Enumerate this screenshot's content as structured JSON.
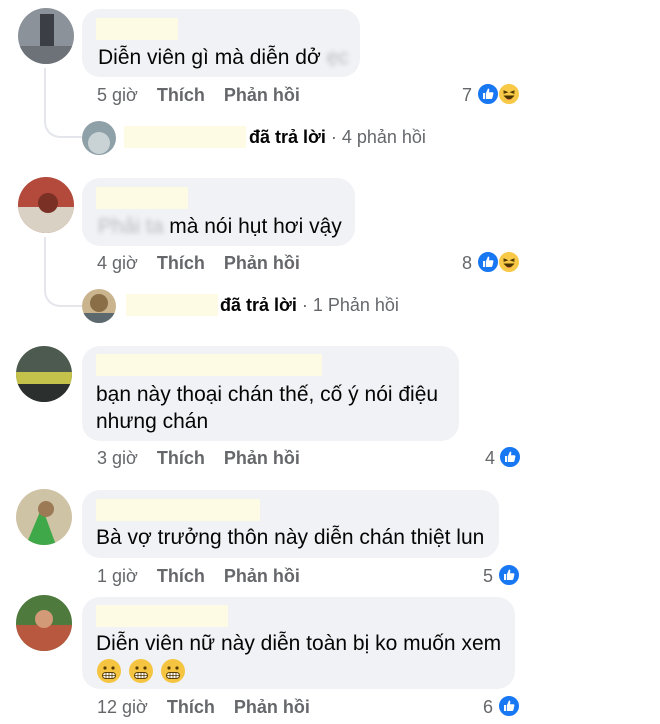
{
  "comments": [
    {
      "text": "Diễn viên gì mà diễn dở",
      "blurred_tail": "ẹc",
      "time": "5 giờ",
      "like": "Thích",
      "reply": "Phản hồi",
      "reaction_count": "7",
      "reactions": [
        "like-icon",
        "haha-icon"
      ],
      "replies": {
        "verb": "đã trả lời",
        "sep": "·",
        "count": "4 phản hồi"
      }
    },
    {
      "blurred_head": "Phải ta",
      "text": "mà nói hụt hơi vậy",
      "time": "4 giờ",
      "like": "Thích",
      "reply": "Phản hồi",
      "reaction_count": "8",
      "reactions": [
        "like-icon",
        "haha-icon"
      ],
      "replies": {
        "verb": "đã trả lời",
        "sep": "·",
        "count": "1 Phản hồi"
      }
    },
    {
      "text_line1": "bạn này thoại chán thế, cố ý nói điệu",
      "text_line2": "nhưng chán",
      "time": "3 giờ",
      "like": "Thích",
      "reply": "Phản hồi",
      "reaction_count": "4",
      "reactions": [
        "like-icon"
      ]
    },
    {
      "text": "Bà vợ trưởng thôn này diễn chán thiệt lun",
      "time": "1 giờ",
      "like": "Thích",
      "reply": "Phản hồi",
      "reaction_count": "5",
      "reactions": [
        "like-icon"
      ]
    },
    {
      "text": "Diễn viên nữ này diễn toàn bị ko muốn xem",
      "emojis": [
        "grimacing-face-icon",
        "grimacing-face-icon",
        "grimacing-face-icon"
      ],
      "time": "12 giờ",
      "like": "Thích",
      "reply": "Phản hồi",
      "reaction_count": "6",
      "reactions": [
        "like-icon"
      ]
    }
  ],
  "colors": {
    "bubble": "#f0f2f5",
    "meta_text": "#65676b",
    "like_blue": "#1877f2",
    "haha_yellow": "#f7c946",
    "redaction": "#fdfbe3"
  }
}
